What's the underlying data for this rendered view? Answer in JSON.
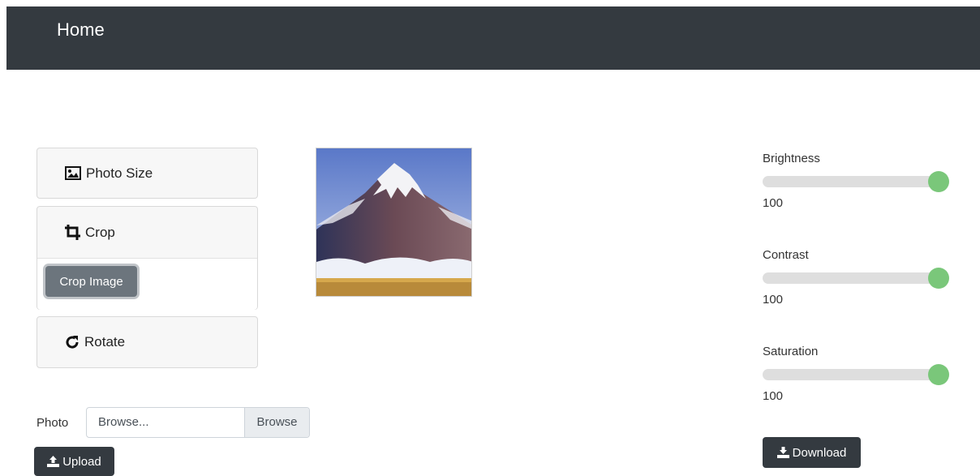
{
  "navbar": {
    "title": "Home"
  },
  "panels": {
    "photo_size": {
      "label": "Photo Size"
    },
    "crop": {
      "label": "Crop",
      "button": "Crop Image"
    },
    "rotate": {
      "label": "Rotate"
    }
  },
  "file": {
    "label": "Photo",
    "placeholder": "Browse...",
    "button": "Browse"
  },
  "upload": {
    "label": "Upload"
  },
  "download": {
    "label": "Download"
  },
  "sliders": [
    {
      "label": "Brightness",
      "value": "100",
      "fraction": 1.0
    },
    {
      "label": "Contrast",
      "value": "100",
      "fraction": 1.0
    },
    {
      "label": "Saturation",
      "value": "100",
      "fraction": 1.0
    }
  ],
  "colors": {
    "navbar": "#343a40",
    "slider_thumb": "#7ac77a",
    "btn_secondary": "#6c757d"
  }
}
